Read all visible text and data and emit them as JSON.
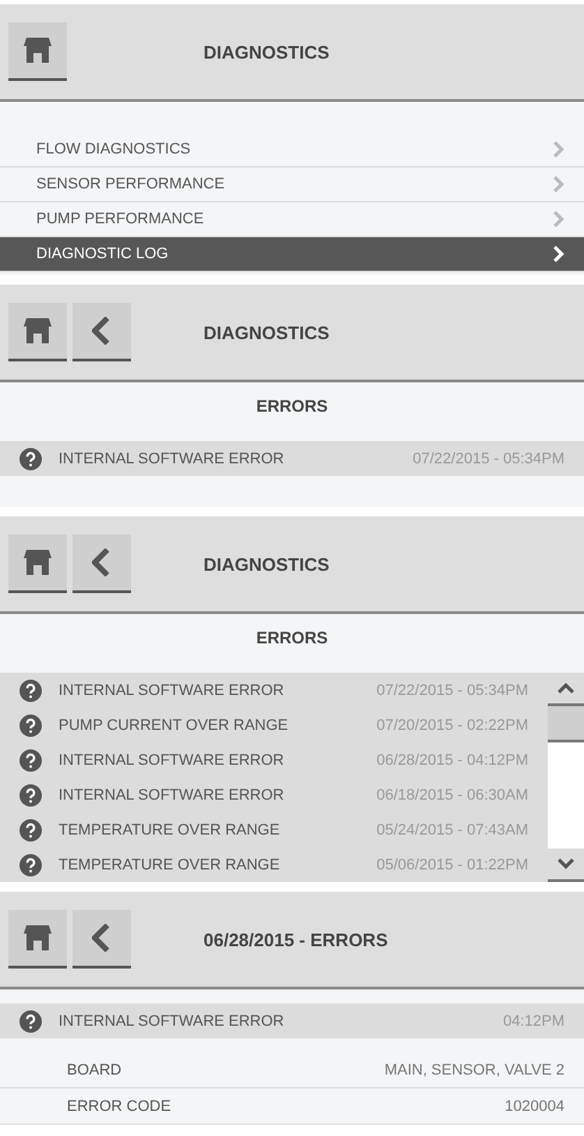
{
  "screens": [
    {
      "kind": "menu",
      "title": "DIAGNOSTICS",
      "back": false,
      "items": [
        {
          "label": "FLOW DIAGNOSTICS",
          "selected": false
        },
        {
          "label": "SENSOR PERFORMANCE",
          "selected": false
        },
        {
          "label": "PUMP PERFORMANCE",
          "selected": false
        },
        {
          "label": "DIAGNOSTIC LOG",
          "selected": true
        }
      ]
    },
    {
      "kind": "errors",
      "title": "DIAGNOSTICS",
      "back": true,
      "subtitle": "ERRORS",
      "scrollable": false,
      "rows": [
        {
          "name": "INTERNAL SOFTWARE ERROR",
          "time": "07/22/2015 - 05:34PM"
        }
      ]
    },
    {
      "kind": "errors",
      "title": "DIAGNOSTICS",
      "back": true,
      "subtitle": "ERRORS",
      "scrollable": true,
      "rows": [
        {
          "name": "INTERNAL SOFTWARE ERROR",
          "time": "07/22/2015 - 05:34PM"
        },
        {
          "name": "PUMP CURRENT OVER RANGE",
          "time": "07/20/2015 - 02:22PM"
        },
        {
          "name": "INTERNAL SOFTWARE ERROR",
          "time": "06/28/2015 - 04:12PM"
        },
        {
          "name": "INTERNAL SOFTWARE ERROR",
          "time": "06/18/2015 - 06:30AM"
        },
        {
          "name": "TEMPERATURE OVER RANGE",
          "time": "05/24/2015 - 07:43AM"
        },
        {
          "name": "TEMPERATURE OVER RANGE",
          "time": "05/06/2015 - 01:22PM"
        }
      ]
    },
    {
      "kind": "detail",
      "title": "06/28/2015 - ERRORS",
      "back": true,
      "row": {
        "name": "INTERNAL SOFTWARE ERROR",
        "time": "04:12PM"
      },
      "fields": [
        {
          "label": "BOARD",
          "value": "MAIN, SENSOR, VALVE 2"
        },
        {
          "label": "ERROR CODE",
          "value": "1020004"
        }
      ]
    }
  ]
}
